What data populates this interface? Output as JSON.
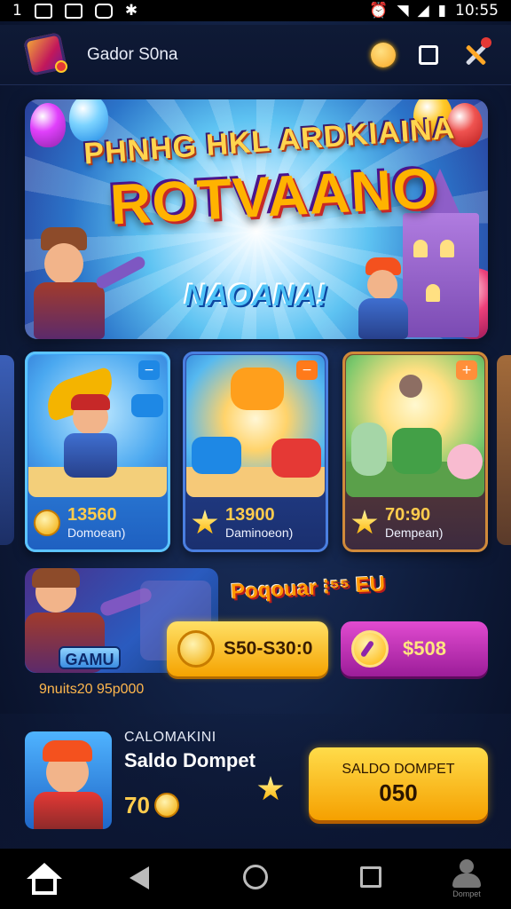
{
  "status_bar": {
    "left_text": "1",
    "time": "10:55",
    "icons": [
      "gallery-icon",
      "sim-icon",
      "app-icon",
      "bluetooth-icon",
      "alarm-icon",
      "wifi-icon",
      "signal-icon",
      "battery-icon"
    ]
  },
  "header": {
    "title": "Gador S0na",
    "icons": [
      "app-logo-icon",
      "coin-icon",
      "square-icon",
      "tools-icon"
    ]
  },
  "hero": {
    "line1": "PHNHG HKL ARDKIAINA",
    "line2": "ROTVAANO",
    "line3": "NAOANA!"
  },
  "cards": [
    {
      "number": "13560",
      "label": "Domoean)",
      "badge": "−",
      "icon": "coin-arrow-icon"
    },
    {
      "number": "13900",
      "label": "Daminoeon)",
      "badge": "−",
      "icon": "star-icon"
    },
    {
      "number": "70:90",
      "label": "Dempean)",
      "badge": "+",
      "icon": "star-icon"
    }
  ],
  "promo": {
    "title": "Poqouar ⁝⁵⁵ EU",
    "thumb_label": "GAMU",
    "yellow_button": "S50-S30:0",
    "purple_button": "$508",
    "footer": "9nuits20 95p000"
  },
  "wallet": {
    "small_label": "CALOMAKINI",
    "name": "Saldo Dompet",
    "amount": "70",
    "button_label": "SALDO DOMPET",
    "button_value": "050"
  },
  "navbar": {
    "user_label": "Dompet"
  },
  "colors": {
    "accent_yellow": "#ffcc4d",
    "accent_purple": "#c02bb8",
    "background": "#0f1d3d"
  }
}
